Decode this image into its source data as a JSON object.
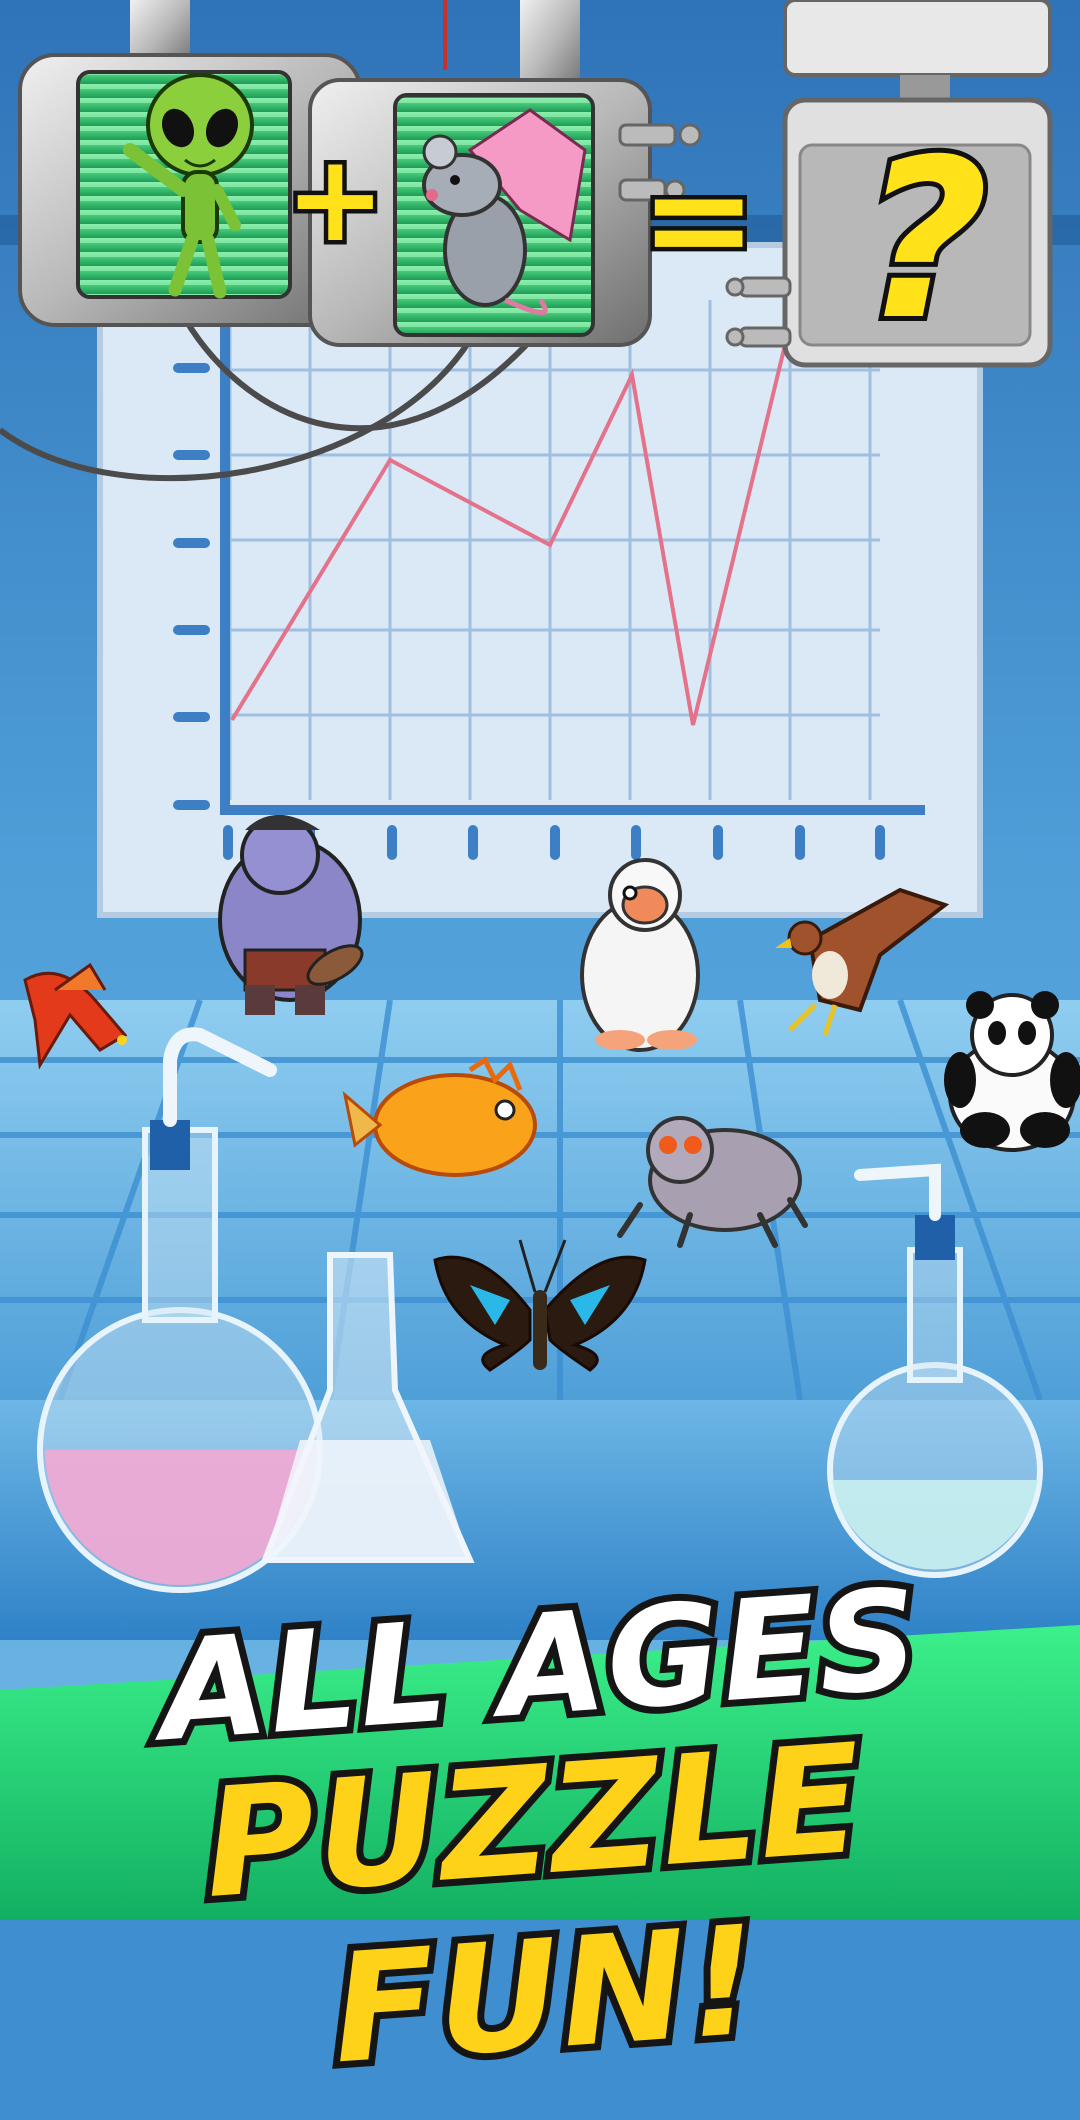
{
  "game": {
    "formula": {
      "plus_symbol": "+",
      "equals_symbol": "=",
      "result_symbol": "?",
      "left_creature_icon": "alien-icon",
      "right_creature_icon": "winged-rat-icon"
    },
    "creatures": [
      {
        "icon": "troll-icon"
      },
      {
        "icon": "yeti-icon"
      },
      {
        "icon": "eagle-icon"
      },
      {
        "icon": "red-dragon-icon"
      },
      {
        "icon": "panda-icon"
      },
      {
        "icon": "orange-fish-icon"
      },
      {
        "icon": "gray-rat-monster-icon"
      },
      {
        "icon": "butterfly-icon"
      }
    ],
    "tagline": {
      "line1": "ALL AGES",
      "line2": "PUZZLE FUN!"
    },
    "colors": {
      "sky_blue": "#3f8fd0",
      "banner_green": "#2fe07a",
      "tagline_yellow": "#ffd21a",
      "chart_line": "#e4728a"
    }
  }
}
